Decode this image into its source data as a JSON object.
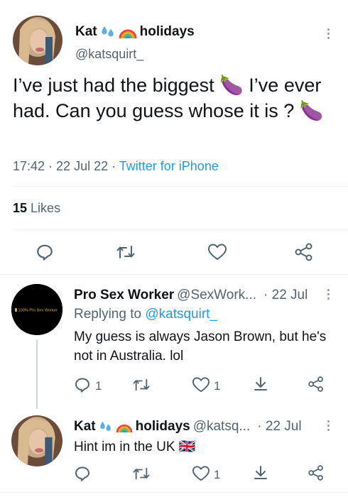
{
  "main_tweet": {
    "author_name": "Kat",
    "author_suffix": "holidays",
    "handle": "@katsquirt_",
    "text": "I’ve just had the biggest 🍆 I’ve ever had. Can you guess whose it is ? 🍆",
    "time": "17:42",
    "date": "22 Jul 22",
    "source": "Twitter for iPhone",
    "likes_count": "15",
    "likes_label": "Likes"
  },
  "replies": [
    {
      "author_name": "Pro Sex Worker",
      "handle": "@SexWork...",
      "date": "· 22 Jul",
      "avatar_text": "100% Pro Sex Worker",
      "replying_prefix": "Replying to",
      "replying_to": "@katsquirt_",
      "text": "My guess is always Jason Brown, but he's not in Australia. lol",
      "reply_count": "1",
      "retweet_count": "",
      "like_count": "1"
    },
    {
      "author_name": "Kat",
      "author_suffix": "holidays",
      "handle": "@katsq...",
      "date": "· 22 Jul",
      "text": "Hint im in the UK 🇬🇧",
      "reply_count": "",
      "retweet_count": "",
      "like_count": "1"
    }
  ],
  "colors": {
    "accent": "#1d9bf0",
    "text": "#0f1419",
    "secondary": "#536471",
    "divider": "#eff3f4"
  },
  "icons": [
    "reply-icon",
    "retweet-icon",
    "like-icon",
    "share-icon",
    "download-icon",
    "more-icon",
    "droplets-emoji",
    "rainbow-emoji"
  ]
}
